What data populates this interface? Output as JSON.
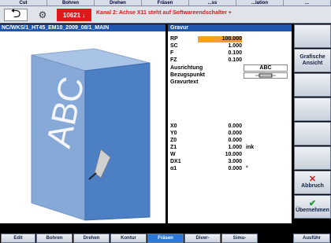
{
  "top_softkeys": [
    "Cut",
    "Bohren",
    "Drehen",
    "Fräsen",
    "...ss",
    "...lation",
    "..."
  ],
  "status": {
    "alarm_number": "10621",
    "alarm_arrow": "↓",
    "alarm_text": "Kanal 2: Achse X11 steht auf Softwareendschalter +"
  },
  "program_path": "NC/WKS/1_HT45_EM10_2009_08/1_MAIN",
  "form": {
    "title": "Gravur",
    "fields_top": [
      {
        "label": "RP",
        "value": "100.000",
        "active": true
      },
      {
        "label": "SC",
        "value": "1.000"
      },
      {
        "label": "F",
        "value": "0.100"
      },
      {
        "label": "FZ",
        "value": "0.100"
      }
    ],
    "ausrichtung_label": "Ausrichtung",
    "ausrichtung_value": "ABC",
    "bezugspunkt_label": "Bezugspunkt",
    "gravurtext_label": "Gravurtext",
    "fields_bottom": [
      {
        "label": "X0",
        "value": "0.000",
        "unit": ""
      },
      {
        "label": "Y0",
        "value": "0.000",
        "unit": ""
      },
      {
        "label": "Z0",
        "value": "0.000",
        "unit": ""
      },
      {
        "label": "Z1",
        "value": "1.000",
        "unit": "ink"
      },
      {
        "label": "W",
        "value": "10.000",
        "unit": ""
      },
      {
        "label": "DX1",
        "value": "3.000",
        "unit": ""
      },
      {
        "label": "α1",
        "value": "0.000",
        "unit": "°"
      }
    ]
  },
  "preview": {
    "engraved_text": "ABC"
  },
  "right_softkeys": {
    "grafische_ansicht": [
      "Grafische",
      "Ansicht"
    ],
    "abbruch": "Abbruch",
    "uebernehmen": "Übernehmen"
  },
  "bottom_softkeys": [
    "Edit",
    "Bohren",
    "Drehen",
    "Kontur",
    "Fräsen",
    "Diver-",
    "Simu-",
    "Ausführ"
  ]
}
